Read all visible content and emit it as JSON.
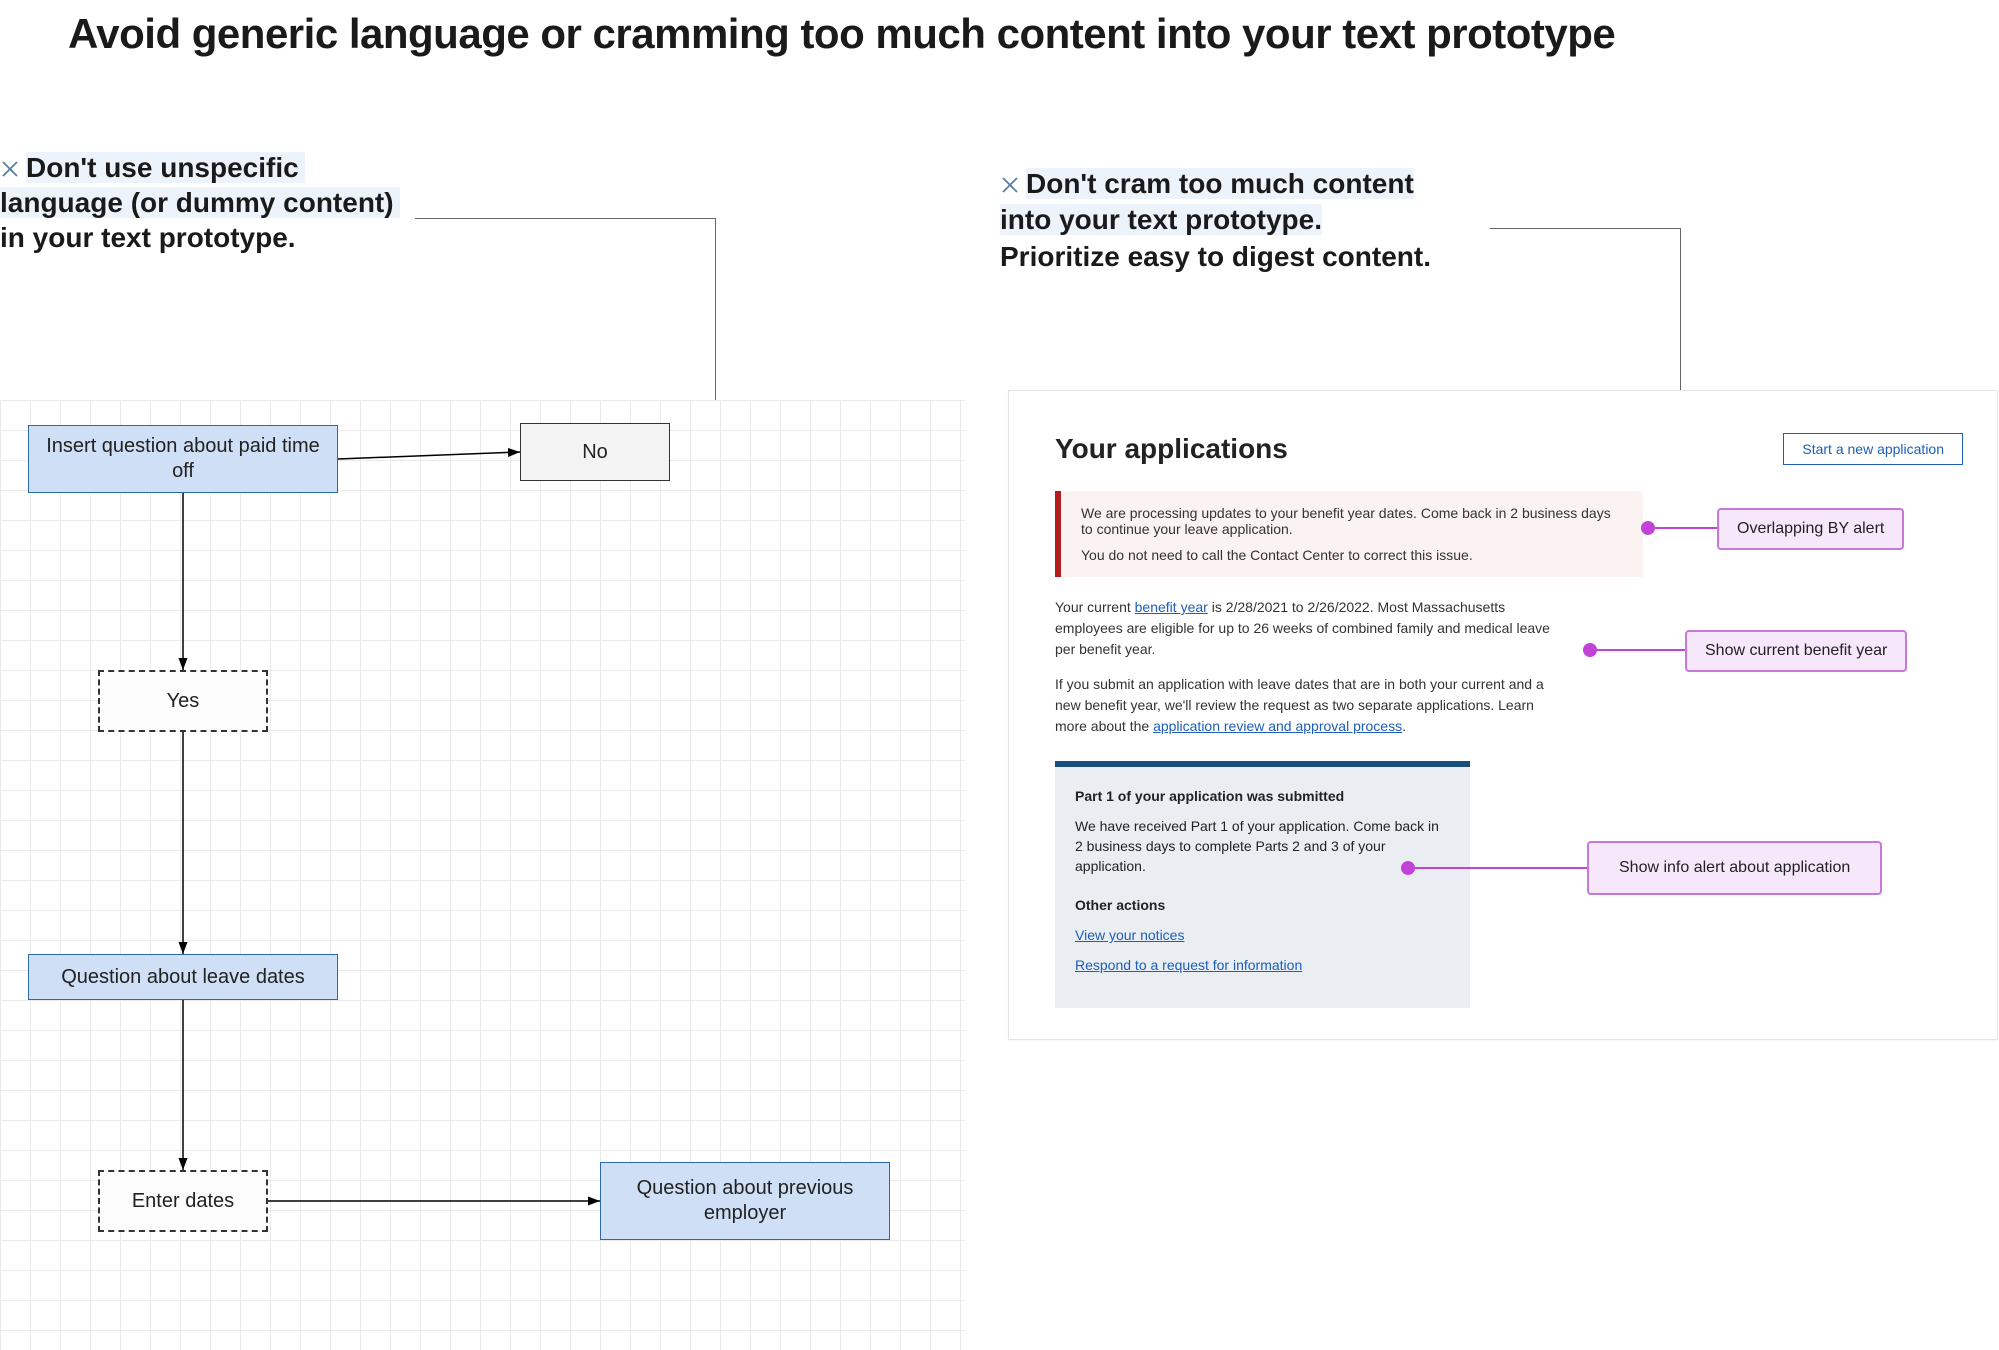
{
  "title": "Avoid generic language or cramming too much content into your text prototype",
  "left": {
    "caption_line1": "Don't use unspecific",
    "caption_line2": "language (or dummy content)",
    "caption_line3": "in your text prototype.",
    "nodes": {
      "pto": "Insert question about paid time off",
      "no": "No",
      "yes": "Yes",
      "q2": "Question about leave dates",
      "enter": "Enter dates",
      "q3": "Question about previous employer"
    }
  },
  "right": {
    "caption_line1": "Don't cram too much content",
    "caption_line2": "into your text prototype.",
    "caption_line3": "Prioritize easy to digest content.",
    "mock": {
      "title": "Your applications",
      "button": "Start a new application",
      "alert_p1": "We are processing updates to your benefit year dates. Come back in 2 business days to continue your leave application.",
      "alert_p2": "You do not need to call the Contact Center to correct this issue.",
      "body_before_link": "Your current ",
      "body_link": "benefit year",
      "body_after_link": " is 2/28/2021 to 2/26/2022. Most Massachusetts employees are eligible for up to 26 weeks of combined family and medical leave per benefit year.",
      "body2_before_link": "If you submit an application with leave dates that are in both your current and a new benefit year, we'll review the request as two separate applications. Learn more about the ",
      "body2_link": "application review and approval process",
      "body2_after_link": ".",
      "card_title": "Part 1 of your application was submitted",
      "card_body": "We have received Part 1 of your application. Come back in 2 business days to complete Parts 2 and 3 of your application.",
      "card_other": "Other actions",
      "card_link1": "View your notices",
      "card_link2": "Respond to a request for information"
    },
    "callouts": {
      "c1": "Overlapping BY alert",
      "c2": "Show current benefit year",
      "c3": "Show info alert about application"
    }
  }
}
